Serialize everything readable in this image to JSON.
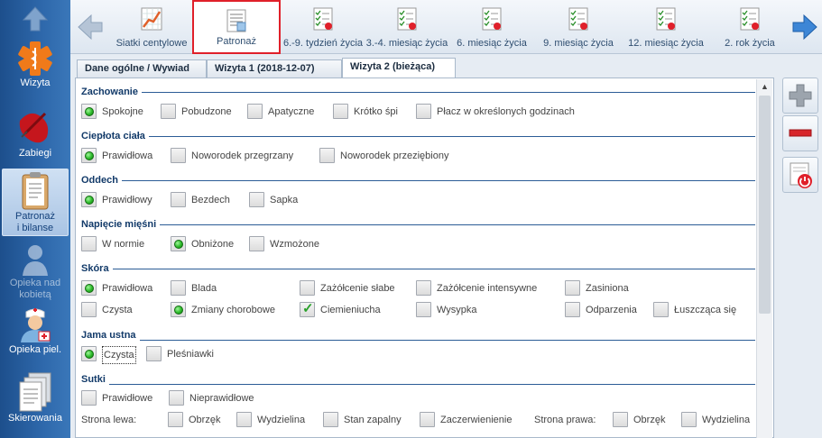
{
  "sidebar": {
    "items": [
      {
        "label": "Wizyta",
        "icon": "medical-star-icon"
      },
      {
        "label": "Zabiegi",
        "icon": "syringe-icon"
      },
      {
        "label": "Patronaż i bilanse",
        "label1": "Patronaż",
        "label2": "i bilanse",
        "icon": "clipboard-icon"
      },
      {
        "label": "Opieka nad kobietą",
        "label1": "Opieka nad",
        "label2": "kobietą",
        "icon": "woman-icon"
      },
      {
        "label": "Opieka piel.",
        "icon": "nurse-icon"
      },
      {
        "label": "Skierowania",
        "icon": "documents-icon"
      }
    ]
  },
  "toolbar": {
    "items": [
      {
        "label": "Siatki centylowe"
      },
      {
        "label": "Patronaż"
      },
      {
        "label": "6.-9. tydzień życia"
      },
      {
        "label": "3.-4. miesiąc życia"
      },
      {
        "label": "6. miesiąc życia"
      },
      {
        "label": "9. miesiąc życia"
      },
      {
        "label": "12. miesiąc życia"
      },
      {
        "label": "2. rok życia"
      }
    ]
  },
  "tabs": [
    {
      "label": "Dane ogólne / Wywiad"
    },
    {
      "label": "Wizyta 1 (2018-12-07)"
    },
    {
      "label": "Wizyta 2 (bieżąca)"
    }
  ],
  "sections": {
    "zachowanie": {
      "title": "Zachowanie",
      "options": [
        "Spokojne",
        "Pobudzone",
        "Apatyczne",
        "Krótko śpi",
        "Płacz w określonych godzinach"
      ]
    },
    "cieplota": {
      "title": "Ciepłota ciała",
      "options": [
        "Prawidłowa",
        "Noworodek przegrzany",
        "Noworodek przeziębiony"
      ]
    },
    "oddech": {
      "title": "Oddech",
      "options": [
        "Prawidłowy",
        "Bezdech",
        "Sapka"
      ]
    },
    "napiecie": {
      "title": "Napięcie mięśni",
      "options": [
        "W normie",
        "Obniżone",
        "Wzmożone"
      ]
    },
    "skora": {
      "title": "Skóra",
      "options": [
        "Prawidłowa",
        "Blada",
        "Zażółcenie słabe",
        "Zażółcenie intensywne",
        "Zasiniona",
        "Czysta",
        "Zmiany chorobowe",
        "Ciemieniucha",
        "Wysypka",
        "Odparzenia",
        "Łuszcząca się"
      ]
    },
    "jama": {
      "title": "Jama ustna",
      "options": [
        "Czysta",
        "Pleśniawki"
      ]
    },
    "sutki": {
      "title": "Sutki",
      "options": [
        "Prawidłowe",
        "Nieprawidłowe"
      ],
      "left_label": "Strona lewa:",
      "right_label": "Strona prawa:",
      "left_options": [
        "Obrzęk",
        "Wydzielina",
        "Stan zapalny",
        "Zaczerwienienie"
      ],
      "right_options": [
        "Obrzęk",
        "Wydzielina"
      ]
    }
  },
  "colors": {
    "accent": "#123a69",
    "selected_border": "#e0202a",
    "radio_green": "#2dbb2a"
  }
}
